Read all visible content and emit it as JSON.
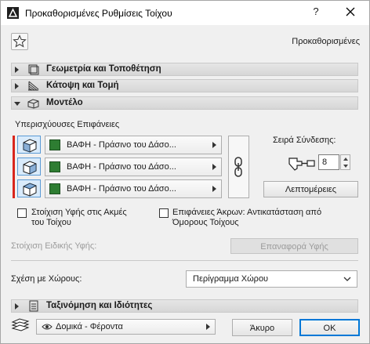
{
  "window": {
    "title": "Προκαθορισμένες Ρυθμίσεις Τοίχου",
    "help_label": "?",
    "preset_label": "Προκαθορισμένες"
  },
  "sections": {
    "geometry": "Γεωμετρία και Τοποθέτηση",
    "floor_plan": "Κάτοψη και Τομή",
    "model": "Μοντέλο",
    "classification": "Ταξινόμηση και Ιδιότητες"
  },
  "model": {
    "override_label": "Υπερισχύουσες Επιφάνειες",
    "surfaces": [
      {
        "material": "ΒΑΦΗ - Πράσινο του Δάσο...",
        "color": "#2e7d32"
      },
      {
        "material": "ΒΑΦΗ - Πράσινο του Δάσο...",
        "color": "#2e7d32"
      },
      {
        "material": "ΒΑΦΗ - Πράσινο του Δάσο...",
        "color": "#2e7d32"
      }
    ],
    "connection_order_label": "Σειρά Σύνδεσης:",
    "connection_order_value": "8",
    "details_button": "Λεπτομέρειες",
    "align_texture_label": "Στοίχιση Υφής στις Ακμές του Τοίχου",
    "edge_surfaces_label": "Επιφάνειες Άκρων: Αντικατάσταση από Όμορους Τοίχους",
    "custom_texture_label": "Στοίχιση Ειδικής Υφής:",
    "reset_texture_button": "Επαναφορά Υφής"
  },
  "zones": {
    "relation_label": "Σχέση με Χώρους:",
    "selected": "Περίγραμμα Χώρου"
  },
  "footer": {
    "layer_value": "Δομικά - Φέροντα",
    "cancel": "Άκυρο",
    "ok": "OK"
  },
  "colors": {
    "accent": "#0078d7",
    "highlight_bar": "#d9261c",
    "selected_icon_bg": "#d9ebfb"
  }
}
